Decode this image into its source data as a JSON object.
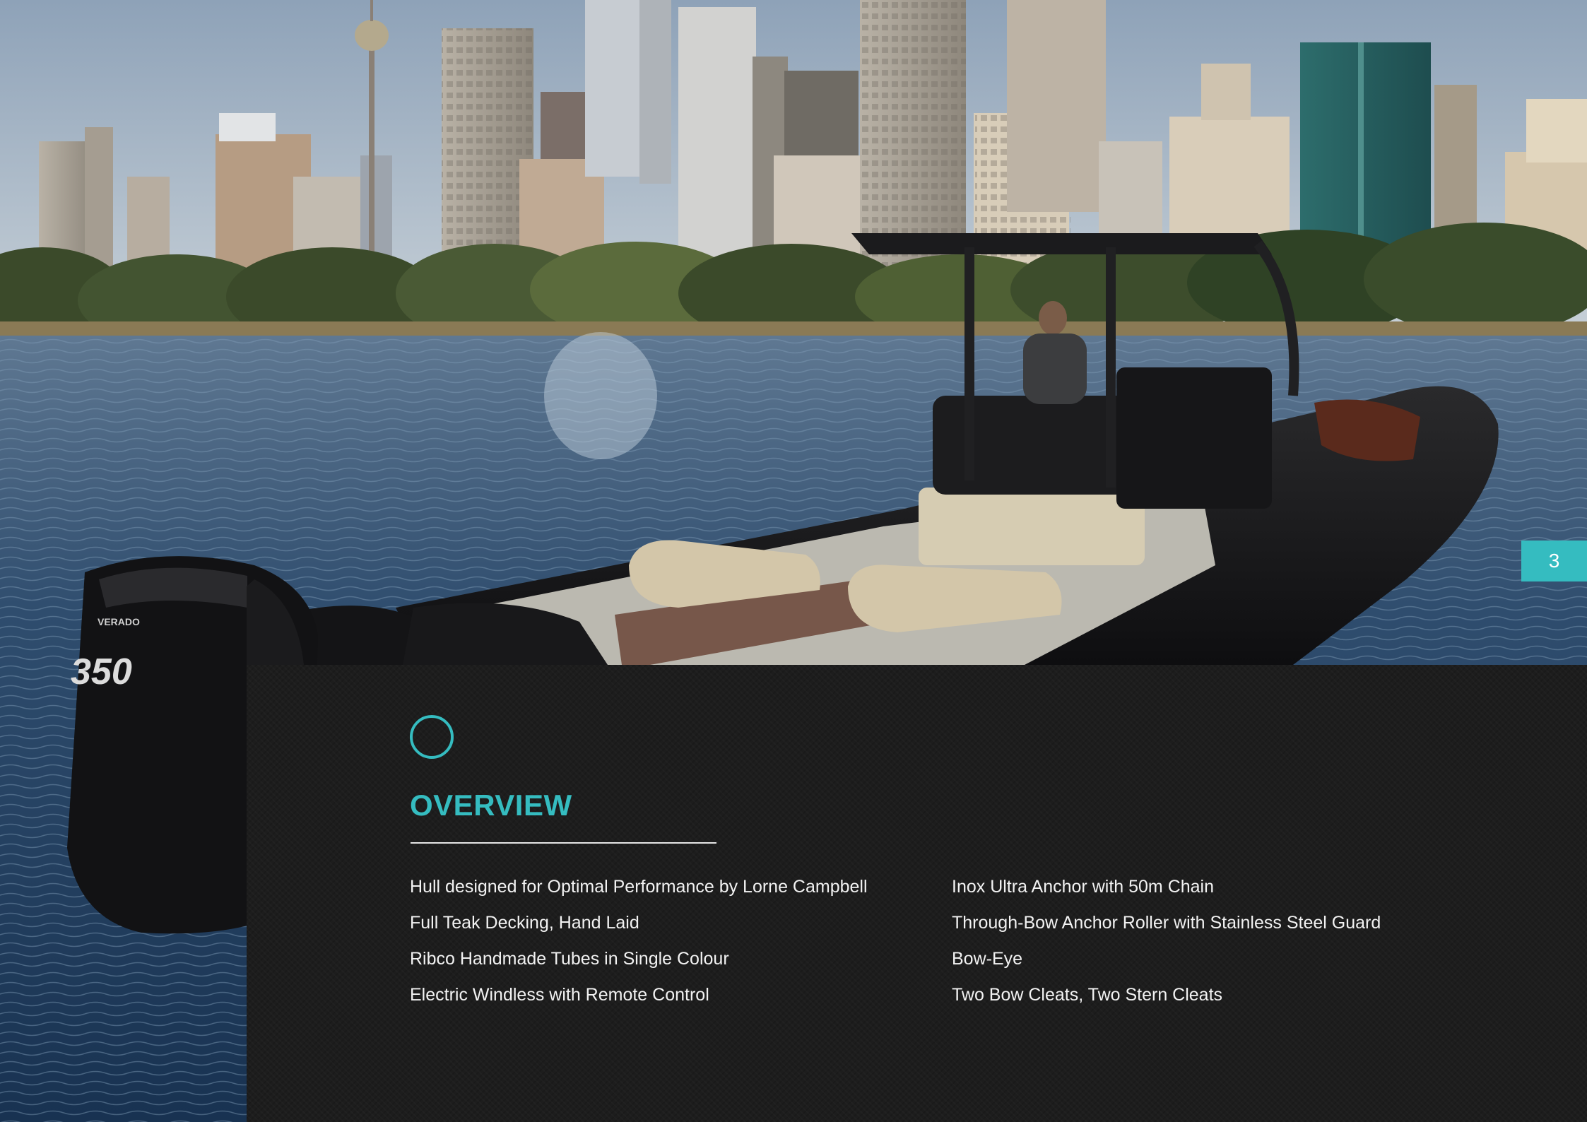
{
  "page_number": "3",
  "section": {
    "title": "OVERVIEW"
  },
  "features": {
    "left": [
      "Hull designed for Optimal Performance by Lorne Campbell",
      "Full Teak Decking, Hand Laid",
      "Ribco Handmade Tubes in Single Colour",
      "Electric Windless with Remote Control"
    ],
    "right": [
      "Inox Ultra Anchor with 50m Chain",
      "Through-Bow Anchor Roller with Stainless Steel Guard",
      "Bow-Eye",
      "Two Bow Cleats, Two Stern Cleats"
    ]
  },
  "photo": {
    "engine_label": "350",
    "engine_brand": "VERADO"
  },
  "colors": {
    "accent": "#35bcc0",
    "panel": "#1d1d1d",
    "text": "#f2f2f2"
  }
}
